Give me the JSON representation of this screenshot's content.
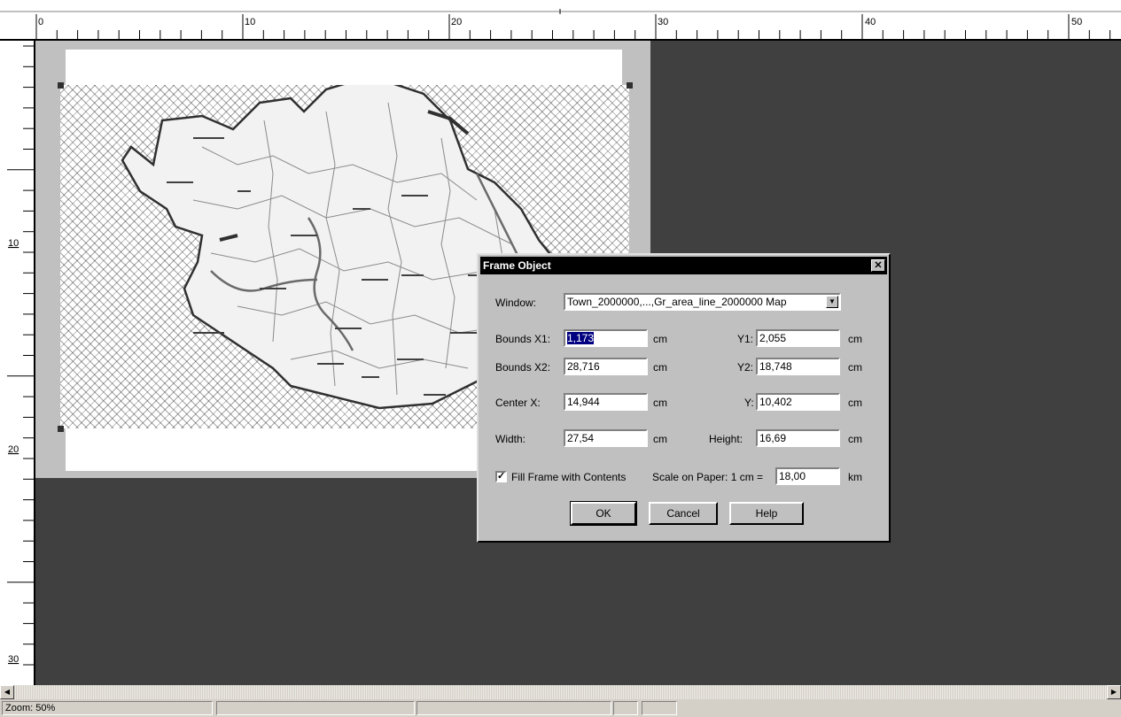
{
  "rulers": {
    "horizontal_labels": [
      "0",
      "10",
      "20",
      "30",
      "40",
      "50"
    ],
    "vertical_labels": [
      "10",
      "20",
      "30"
    ]
  },
  "dialog": {
    "title": "Frame Object",
    "close_label": "✕",
    "window_label": "Window:",
    "window_value": "Town_2000000,...,Gr_area_line_2000000 Map",
    "bounds_x1_label": "Bounds X1:",
    "bounds_x1_value": "1,173",
    "bounds_x2_label": "Bounds X2:",
    "bounds_x2_value": "28,716",
    "y1_label": "Y1:",
    "y1_value": "2,055",
    "y2_label": "Y2:",
    "y2_value": "18,748",
    "center_x_label": "Center X:",
    "center_x_value": "14,944",
    "center_y_label": "Y:",
    "center_y_value": "10,402",
    "width_label": "Width:",
    "width_value": "27,54",
    "height_label": "Height:",
    "height_value": "16,69",
    "unit": "cm",
    "fill_frame_label": "Fill Frame with Contents",
    "fill_frame_checked": true,
    "scale_label": "Scale on Paper: 1 cm =",
    "scale_value": "18,00",
    "scale_unit": "km",
    "ok_label": "OK",
    "cancel_label": "Cancel",
    "help_label": "Help"
  },
  "statusbar": {
    "zoom": "Zoom: 50%"
  }
}
